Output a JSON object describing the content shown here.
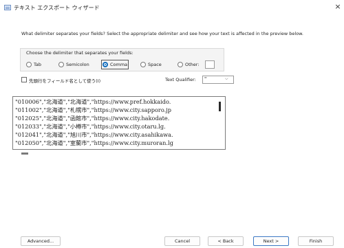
{
  "window": {
    "title": "テキスト エクスポート ウィザード",
    "close_glyph": "×",
    "icon": "app-icon"
  },
  "question": "What delimiter separates your fields? Select the appropriate delimiter and see how your text is affected in the preview below.",
  "delimiter_group": {
    "label": "Choose the delimiter that separates your fields:",
    "options": [
      {
        "label": "Tab",
        "checked": false
      },
      {
        "label": "Semicolon",
        "checked": false
      },
      {
        "label": "Comma",
        "checked": true
      },
      {
        "label": "Space",
        "checked": false
      },
      {
        "label": "Other:",
        "checked": false
      }
    ],
    "other_value": ""
  },
  "first_row_checkbox": {
    "label": "先頭行をフィールド名として使う(I)",
    "checked": false
  },
  "text_qualifier": {
    "label": "Text Qualifier:",
    "value": "\""
  },
  "preview_lines": [
    "\"010006\",\"北海道\",\"北海道\",\"https://www.pref.hokkaido.",
    "\"011002\",\"北海道\",\"札幌市\",\"https://www.city.sapporo.jp",
    "\"012025\",\"北海道\",\"函館市\",\"https://www.city.hakodate.",
    "\"012033\",\"北海道\",\"小樽市\",\"https://www.city.otaru.lg.",
    "\"012041\",\"北海道\",\"旭川市\",\"https://www.city.asahikawa.",
    "\"012050\",\"北海道\",\"室蘭市\",\"https://www.city.muroran.lg"
  ],
  "buttons": {
    "advanced": "Advanced...",
    "cancel": "Cancel",
    "back": "< Back",
    "next": "Next >",
    "finish": "Finish"
  }
}
